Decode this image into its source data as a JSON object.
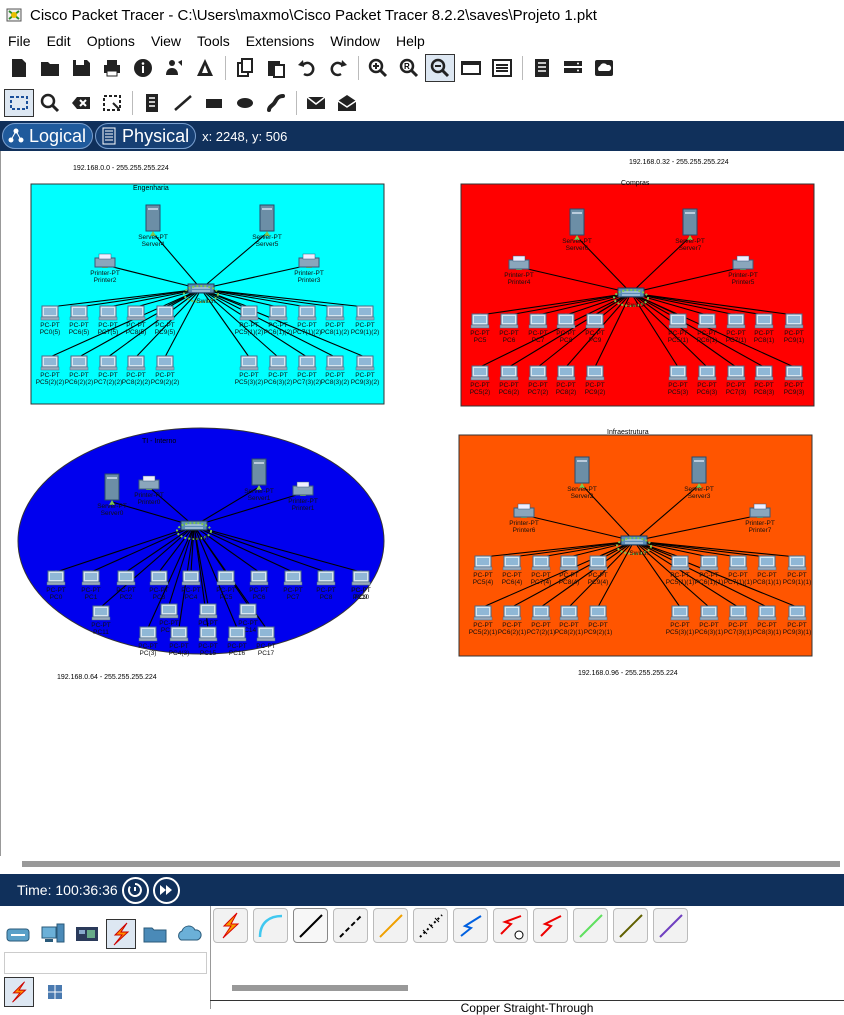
{
  "window": {
    "title": "Cisco Packet Tracer - C:\\Users\\maxmo\\Cisco Packet Tracer 8.2.2\\saves\\Projeto 1.pkt"
  },
  "menu": [
    "File",
    "Edit",
    "Options",
    "View",
    "Tools",
    "Extensions",
    "Window",
    "Help"
  ],
  "toolbar1": [
    "new-icon",
    "open-icon",
    "save-icon",
    "print-icon",
    "info-icon",
    "network-wizard-icon",
    "ipv4-icon",
    "copy-icon",
    "paste-icon",
    "undo-icon",
    "redo-icon",
    "zoom-in-icon",
    "zoom-reset-icon",
    "zoom-out-icon",
    "drawing-palette-icon",
    "custom-device-icon",
    "pdu-list-icon",
    "rack-icon",
    "cloud-view-icon"
  ],
  "toolbar2": [
    "select-icon",
    "inspect-icon",
    "delete-icon",
    "resize-icon",
    "note-icon",
    "line-icon",
    "rectangle-icon",
    "ellipse-icon",
    "freeform-icon",
    "simple-pdu-icon",
    "complex-pdu-icon"
  ],
  "modes": {
    "logical": "Logical",
    "physical": "Physical",
    "coords": "x: 2248, y: 506"
  },
  "canvas": {
    "zones": [
      {
        "name": "Engenharia",
        "subnet": "192.168.0.0 - 255.255.255.224",
        "color": "#00ffff"
      },
      {
        "name": "Compras",
        "subnet": "192.168.0.32 - 255.255.255.224",
        "color": "#ff0000"
      },
      {
        "name": "TI - Interno",
        "subnet": "192.168.0.64 - 255.255.255.224",
        "color": "#0000ee"
      },
      {
        "name": "Infraestrutura",
        "subnet": "192.168.0.96 - 255.255.255.224",
        "color": "#ff5500"
      }
    ],
    "switch_label": "Switch",
    "server_label": "Server-PT",
    "printer_label": "Printer-PT",
    "pc_label": "PC-PT",
    "eng": {
      "servers": [
        "Server4",
        "Server5"
      ],
      "printers": [
        "Printer2",
        "Printer3"
      ],
      "pcs_top": [
        "PC0(5)",
        "PC6(5)",
        "PC7(5)",
        "PC8(5)",
        "PC9(5)",
        "PC5(1)(2)",
        "PC6(1)(2)",
        "PC7(1)(2)",
        "PC8(1)(2)",
        "PC9(1)(2)"
      ],
      "pcs_bottom": [
        "PC5(2)(2)",
        "PC6(2)(2)",
        "PC7(2)(2)",
        "PC8(2)(2)",
        "PC9(2)(2)",
        "PC5(3)(2)",
        "PC6(3)(2)",
        "PC7(3)(2)",
        "PC8(3)(2)",
        "PC9(3)(2)"
      ]
    },
    "compras": {
      "servers": [
        "Server6",
        "Server7"
      ],
      "printers": [
        "Printer4",
        "Printer5"
      ],
      "pcs_top": [
        "PC5",
        "PC6",
        "PC7",
        "PC8",
        "PC9",
        "PC5(1)",
        "PC6(1)",
        "PC7(1)",
        "PC8(1)",
        "PC9(1)"
      ],
      "pcs_bottom": [
        "PC5(2)",
        "PC6(2)",
        "PC7(2)",
        "PC8(2)",
        "PC9(2)",
        "PC5(3)",
        "PC6(3)",
        "PC7(3)",
        "PC8(3)",
        "PC9(3)"
      ]
    },
    "ti": {
      "servers": [
        "Server0",
        "Server1"
      ],
      "printers": [
        "Printer0",
        "Printer1"
      ],
      "pcs_top": [
        "PC0",
        "PC1",
        "PC2",
        "PC3",
        "PC4",
        "PC5",
        "PC6",
        "PC7",
        "PC8",
        "PC9",
        "PC10"
      ],
      "pcs_mid": [
        "PC11",
        "PC12",
        "PC13",
        "PC14"
      ],
      "pcs_bottom": [
        "PC(3)",
        "PC4(3)",
        "PC15",
        "PC16",
        "PC17"
      ]
    },
    "infra": {
      "servers": [
        "Server2",
        "Server3"
      ],
      "printers": [
        "Printer6",
        "Printer7"
      ],
      "pcs_top": [
        "PC5(4)",
        "PC6(4)",
        "PC7(4)",
        "PC8(4)",
        "PC9(4)",
        "PC5(1)(1)",
        "PC6(1)(1)",
        "PC7(1)(1)",
        "PC8(1)(1)",
        "PC9(1)(1)"
      ],
      "pcs_bottom": [
        "PC5(2)(1)",
        "PC6(2)(1)",
        "PC7(2)(1)",
        "PC8(2)(1)",
        "PC9(2)(1)",
        "PC5(3)(1)",
        "PC6(3)(1)",
        "PC7(3)(1)",
        "PC8(3)(1)",
        "PC9(3)(1)"
      ]
    }
  },
  "time": {
    "label": "Time: 100:36:36"
  },
  "device_categories": [
    "network-devices-icon",
    "end-devices-icon",
    "components-icon",
    "connections-icon",
    "miscellaneous-icon",
    "multiuser-icon"
  ],
  "cables": [
    {
      "name": "automatic-cable-icon",
      "color": "#e8a000"
    },
    {
      "name": "console-cable-icon",
      "color": "#40c8f0"
    },
    {
      "name": "copper-straight-icon",
      "color": "#000000"
    },
    {
      "name": "copper-cross-icon",
      "color": "#000000"
    },
    {
      "name": "fiber-icon",
      "color": "#f0a000"
    },
    {
      "name": "phone-cable-icon",
      "color": "#000000"
    },
    {
      "name": "coaxial-icon",
      "color": "#0060e0"
    },
    {
      "name": "serial-dce-icon",
      "color": "#e00000"
    },
    {
      "name": "serial-dte-icon",
      "color": "#e00000"
    },
    {
      "name": "octal-cable-icon",
      "color": "#60e060"
    },
    {
      "name": "iot-custom-cable-icon",
      "color": "#606000"
    },
    {
      "name": "usb-cable-icon",
      "color": "#7040c0"
    }
  ],
  "selected_cable_name": "Copper Straight-Through"
}
